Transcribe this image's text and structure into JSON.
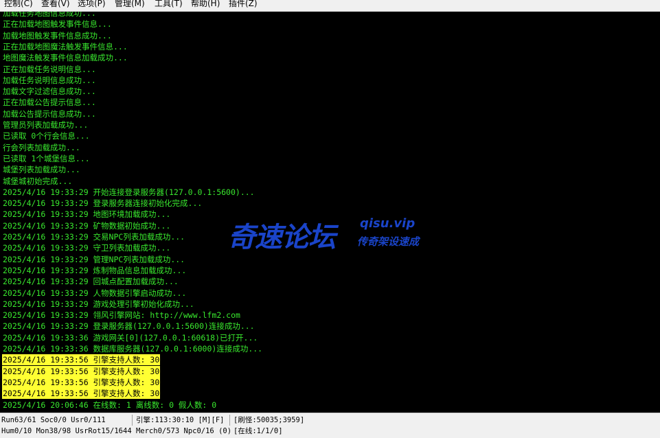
{
  "menu": [
    "控制(C)",
    "查看(V)",
    "选项(P)",
    "管理(M)",
    "工具(T)",
    "帮助(H)",
    "插件(Z)"
  ],
  "log_lines": [
    "加载任务地图信息成功...",
    "正在加载地图触发事件信息...",
    "加载地图触发事件信息成功...",
    "正在加载地图魔法触发事件信息...",
    "地图魔法触发事件信息加载成功...",
    "正在加载任务说明信息...",
    "加载任务说明信息成功...",
    "加载文字过滤信息成功...",
    "正在加载公告提示信息...",
    "加载公告提示信息成功...",
    "管理员列表加载成功...",
    "已读取 0个行会信息...",
    "行会列表加载成功...",
    "已读取 1个城堡信息...",
    "城堡列表加载成功...",
    "城堡城初始完成...",
    "2025/4/16 19:33:29 开始连接登录服务器(127.0.0.1:5600)...",
    "2025/4/16 19:33:29 登录服务器连接初始化完成...",
    "2025/4/16 19:33:29 地图环境加载成功...",
    "2025/4/16 19:33:29 矿物数据初始成功...",
    "2025/4/16 19:33:29 交易NPC列表加载成功...",
    "2025/4/16 19:33:29 守卫列表加载成功...",
    "2025/4/16 19:33:29 管理NPC列表加载成功...",
    "2025/4/16 19:33:29 炼制物品信息加载成功...",
    "2025/4/16 19:33:29 回城点配置加载成功...",
    "2025/4/16 19:33:29 人物数据引擎启动成功...",
    "2025/4/16 19:33:29 游戏处理引擎初始化成功...",
    "2025/4/16 19:33:29 翎风引擎网站: http://www.lfm2.com",
    "2025/4/16 19:33:29 登录服务器(127.0.0.1:5600)连接成功...",
    "2025/4/16 19:33:36 游戏网关[0](127.0.0.1:60618)已打开...",
    "2025/4/16 19:33:36 数据库服务器(127.0.0.1:6000)连接成功...",
    "2025/4/16 19:33:56 引擎支持人数: 30",
    "2025/4/16 19:33:56 引擎支持人数: 30",
    "2025/4/16 19:33:56 引擎支持人数: 30",
    "2025/4/16 19:33:56 引擎支持人数: 30",
    "2025/4/16 20:06:46 在线数: 1 离线数: 0 假人数: 0"
  ],
  "highlight_color": "#ffff33",
  "text_color": "#39e82e",
  "watermark": {
    "main": "奇速论坛",
    "url": "qisu.vip",
    "sub": "传奇架设速成"
  },
  "status": {
    "row1": {
      "a": "Run63/61 Soc0/0 Usr0/111",
      "b": "引擎:113:30:10 [M][F]",
      "c": "[刷怪:50035;3959]"
    },
    "row2": {
      "a": "Hum0/10 Mon38/98 UsrRot15/1644 Merch0/573 Npc0/16 (0)",
      "b": "[在线:1/1/0]"
    }
  }
}
